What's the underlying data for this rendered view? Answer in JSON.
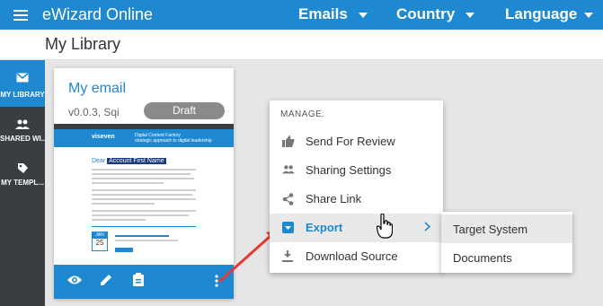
{
  "header": {
    "app_title": "eWizard Online",
    "nav": [
      {
        "label": "Emails"
      },
      {
        "label": "Country"
      },
      {
        "label": "Language"
      }
    ]
  },
  "page": {
    "title": "My Library"
  },
  "sidebar": {
    "items": [
      {
        "label": "MY LIBRARY",
        "icon": "mail-icon",
        "active": true
      },
      {
        "label": "SHARED WI...",
        "icon": "people-icon",
        "active": false
      },
      {
        "label": "MY TEMPL...",
        "icon": "tag-icon",
        "active": false
      }
    ]
  },
  "card": {
    "title": "My email",
    "version": "v0.0.3, Sqi",
    "status": "Draft",
    "thumbnail": {
      "logo": "viseven",
      "headline": "Digital Content Factory",
      "subheadline": "strategic approach to digital leadership",
      "greeting": "Dear",
      "name_placeholder": "Account First Name",
      "cal_month": "JAN",
      "cal_day": "25"
    },
    "footer_icons": [
      "eye-icon",
      "pencil-icon",
      "clipboard-icon",
      "more-vert-icon"
    ]
  },
  "menu": {
    "header": "MANAGE:",
    "items": [
      {
        "label": "Send For Review",
        "icon": "thumb-up-icon"
      },
      {
        "label": "Sharing Settings",
        "icon": "people-icon"
      },
      {
        "label": "Share Link",
        "icon": "share-icon"
      },
      {
        "label": "Export",
        "icon": "export-icon",
        "active": true,
        "has_submenu": true
      },
      {
        "label": "Download Source",
        "icon": "download-icon"
      }
    ]
  },
  "submenu": {
    "items": [
      {
        "label": "Target System",
        "active": true
      },
      {
        "label": "Documents",
        "active": false
      }
    ]
  },
  "colors": {
    "brand": "#1e88d0",
    "sidebar": "#3a3d41",
    "annotation_arrow": "#e53935"
  }
}
